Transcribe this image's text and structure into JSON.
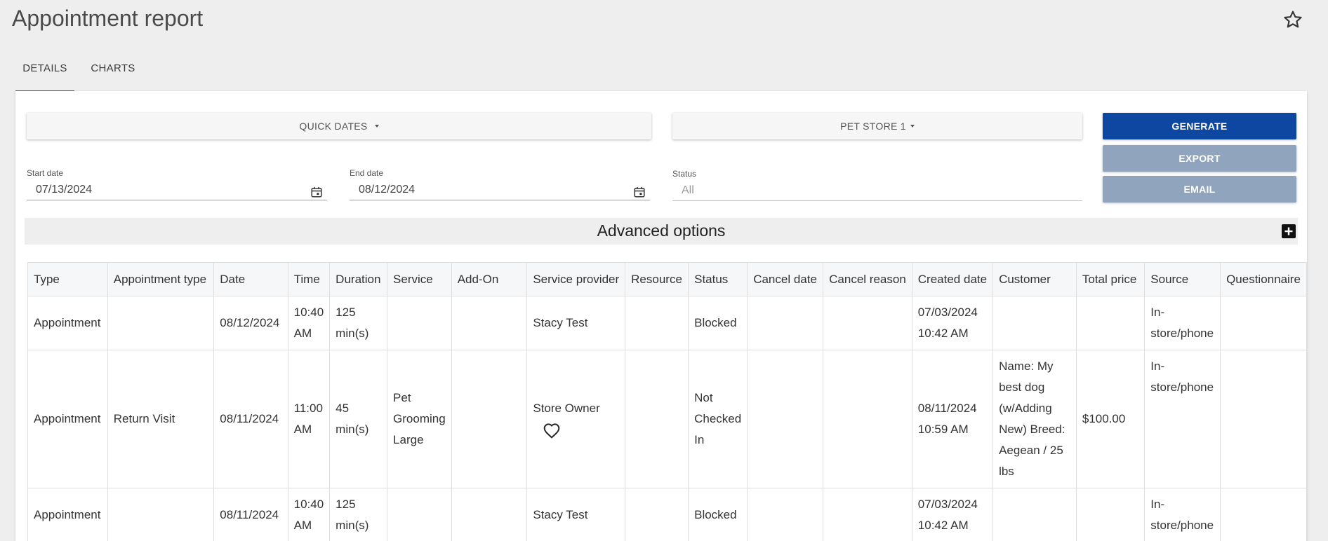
{
  "page": {
    "title": "Appointment report"
  },
  "tabs": [
    {
      "label": "DETAILS"
    },
    {
      "label": "CHARTS"
    }
  ],
  "filters": {
    "quick_dates_label": "QUICK DATES",
    "store_label": "PET STORE 1",
    "start_date_label": "Start date",
    "start_date_value": "07/13/2024",
    "end_date_label": "End date",
    "end_date_value": "08/12/2024",
    "status_label": "Status",
    "status_placeholder": "All"
  },
  "actions": {
    "generate": "GENERATE",
    "export": "EXPORT",
    "email": "EMAIL"
  },
  "advanced": {
    "title": "Advanced options"
  },
  "table": {
    "headers": [
      "Type",
      "Appointment type",
      "Date",
      "Time",
      "Duration",
      "Service",
      "Add-On",
      "Service provider",
      "Resource",
      "Status",
      "Cancel date",
      "Cancel reason",
      "Created date",
      "Customer",
      "Total price",
      "Source",
      "Questionnaire"
    ],
    "rows": [
      {
        "type": "Appointment",
        "appointment_type": "",
        "date": "08/12/2024",
        "time": "10:40 AM",
        "duration": "125 min(s)",
        "service": "",
        "add_on": "",
        "service_provider": "Stacy Test",
        "resource": "",
        "status": "Blocked",
        "cancel_date": "",
        "cancel_reason": "",
        "created_date": "07/03/2024 10:42 AM",
        "customer": "",
        "total_price": "",
        "source": "In-store/phone",
        "questionnaire": ""
      },
      {
        "type": "Appointment",
        "appointment_type": "Return Visit",
        "date": "08/11/2024",
        "time": "11:00 AM",
        "duration": "45 min(s)",
        "service": "Pet Grooming Large",
        "add_on": "",
        "service_provider": "Store Owner",
        "resource": "",
        "status": "Not Checked In",
        "cancel_date": "",
        "cancel_reason": "",
        "created_date": "08/11/2024 10:59 AM",
        "customer": "Name: My best dog (w/Adding New) Breed: Aegean / 25 lbs",
        "total_price": "$100.00",
        "source": "In-store/phone",
        "questionnaire": ""
      },
      {
        "type": "Appointment",
        "appointment_type": "",
        "date": "08/11/2024",
        "time": "10:40 AM",
        "duration": "125 min(s)",
        "service": "",
        "add_on": "",
        "service_provider": "Stacy Test",
        "resource": "",
        "status": "Blocked",
        "cancel_date": "",
        "cancel_reason": "",
        "created_date": "07/03/2024 10:42 AM",
        "customer": "",
        "total_price": "",
        "source": "In-store/phone",
        "questionnaire": ""
      }
    ]
  },
  "icons": {
    "star": "star-outline-icon",
    "calendar": "calendar-icon",
    "plus": "plus-box-icon",
    "heart": "heart-outline-icon"
  },
  "colors": {
    "primary": "#0d47a1",
    "disabled_button": "#90a4bd",
    "tab_indicator": "#1e63d6"
  }
}
